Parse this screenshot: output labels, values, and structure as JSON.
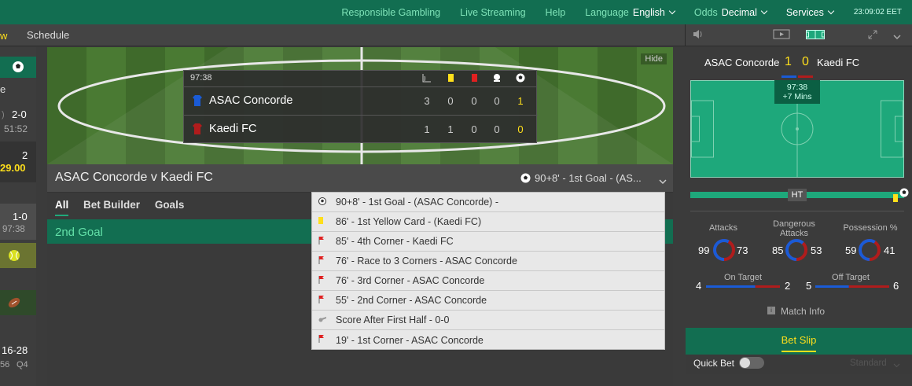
{
  "topbar": {
    "responsible": "Responsible Gambling",
    "streaming": "Live Streaming",
    "help": "Help",
    "language_label": "Language",
    "language_value": "English",
    "odds_label": "Odds",
    "odds_value": "Decimal",
    "services": "Services",
    "clock": "23:09:02 EET"
  },
  "subbar": {
    "tab_partial": "w",
    "schedule": "Schedule"
  },
  "left": {
    "r1": "e",
    "r2a": "2-0",
    "r2b": "51:52",
    "r3a": "2",
    "r3b": "29.00",
    "r4a": "1-0",
    "r4b": "97:38",
    "r5a": "16-28",
    "r5b": "56",
    "r5c": "Q4"
  },
  "video": {
    "hide": "Hide"
  },
  "scoreboard": {
    "time": "97:38",
    "teams": [
      {
        "name": "ASAC Concorde",
        "stats": [
          "3",
          "0",
          "0",
          "0"
        ],
        "score": "1"
      },
      {
        "name": "Kaedi FC",
        "stats": [
          "1",
          "1",
          "0",
          "0"
        ],
        "score": "0"
      }
    ]
  },
  "match": {
    "title": "ASAC Concorde v Kaedi FC",
    "event": "90+8' - 1st Goal - (AS..."
  },
  "tabs": [
    "All",
    "Bet Builder",
    "Goals"
  ],
  "market": "2nd Goal",
  "events": [
    {
      "icon": "ball-icon",
      "text": "90+8' - 1st Goal - (ASAC Concorde) -"
    },
    {
      "icon": "yellow-card-icon",
      "text": "86' - 1st Yellow Card - (Kaedi FC)"
    },
    {
      "icon": "corner-flag-icon",
      "text": "85' - 4th Corner - Kaedi FC"
    },
    {
      "icon": "corner-flag-icon",
      "text": "76' - Race to 3 Corners - ASAC Concorde"
    },
    {
      "icon": "corner-flag-icon",
      "text": "76' - 3rd Corner - ASAC Concorde"
    },
    {
      "icon": "corner-flag-icon",
      "text": "55' - 2nd Corner - ASAC Concorde"
    },
    {
      "icon": "whistle-icon",
      "text": "Score After First Half - 0-0"
    },
    {
      "icon": "corner-flag-icon",
      "text": "19' - 1st Corner - ASAC Concorde"
    }
  ],
  "right": {
    "home": "ASAC Concorde",
    "away": "Kaedi FC",
    "home_score": "1",
    "away_score": "0",
    "time": "97:38",
    "extra": "+7 Mins",
    "ht": "HT",
    "attacks_label": "Attacks",
    "attacks": [
      "99",
      "73"
    ],
    "dangerous_label": "Dangerous Attacks",
    "dangerous": [
      "85",
      "53"
    ],
    "possession_label": "Possession %",
    "possession": [
      "59",
      "41"
    ],
    "on_target_label": "On Target",
    "on_target": [
      "4",
      "2"
    ],
    "off_target_label": "Off Target",
    "off_target": [
      "5",
      "6"
    ],
    "match_info": "Match Info",
    "bet_slip": "Bet Slip",
    "quick_bet": "Quick Bet",
    "standard": "Standard"
  },
  "colors": {
    "brand": "#126e51",
    "accent": "#ffdf1b",
    "home": "#1a5bd6",
    "away": "#b01c1c"
  }
}
